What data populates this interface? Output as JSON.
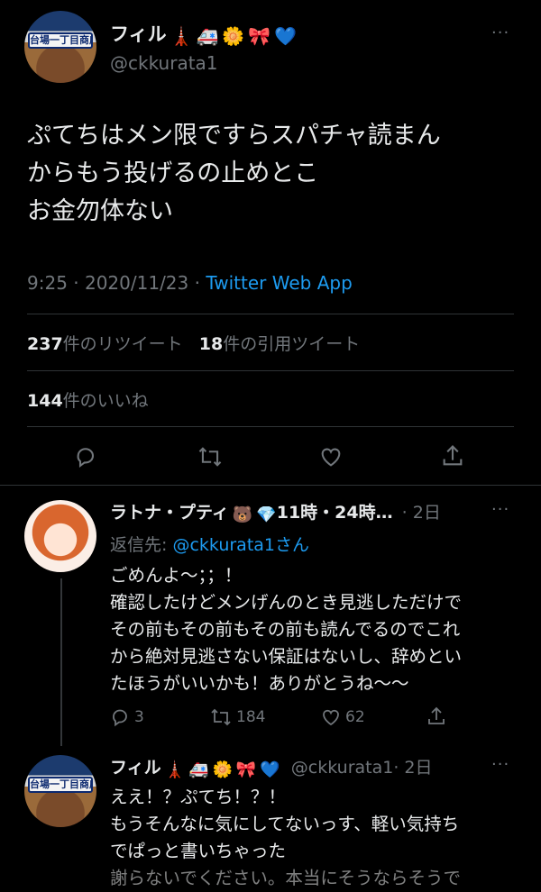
{
  "main_tweet": {
    "display_name": "フィル",
    "emojis": [
      "🗼",
      "🚑",
      "🌼",
      "🎀",
      "💙"
    ],
    "handle": "@ckkurata1",
    "avatar_sign": "台場一丁目商店街",
    "text_lines": [
      "ぷてちはメン限ですらスパチャ読まん",
      "からもう投げるの止めとこ",
      "お金勿体ない"
    ],
    "meta_time": "9:25 · 2020/11/23 · ",
    "meta_source": "Twitter Web App",
    "retweets_count": "237",
    "retweets_label": "件のリツイート",
    "quotes_count": "18",
    "quotes_label": "件の引用ツイート",
    "likes_count": "144",
    "likes_label": "件のいいね",
    "more": "···"
  },
  "reply_1": {
    "display_name": "ラトナ・プティ",
    "emojis": [
      "🐻",
      "💎"
    ],
    "name_tail": "11時・24時…",
    "time": "· 2日",
    "reply_to_prefix": "返信先: ",
    "reply_to_handle": "@ckkurata1",
    "reply_to_suffix": "さん",
    "text_lines": [
      "ごめんよ～；；！",
      "確認したけどメンげんのとき見逃しただけで",
      "その前もその前もその前も読んでるのでこれ",
      "から絶対見逃さない保証はないし、辞めとい",
      "たほうがいいかも！ありがとうね～～"
    ],
    "reply_count": "3",
    "retweet_count": "184",
    "like_count": "62",
    "more": "···"
  },
  "reply_2": {
    "display_name": "フィル",
    "emojis": [
      "🗼",
      "🚑",
      "🌼",
      "🎀",
      "💙"
    ],
    "handle": "@ckkurata1",
    "time": "· 2日",
    "avatar_sign": "台場一丁目商店街",
    "text_lines": [
      "ええ！？ぷてち！？！",
      "もうそんなに気にしてないっす、軽い気持ち",
      "でぱっと書いちゃった",
      "謝らないでください。本当にそうならそうで"
    ],
    "more": "···"
  }
}
